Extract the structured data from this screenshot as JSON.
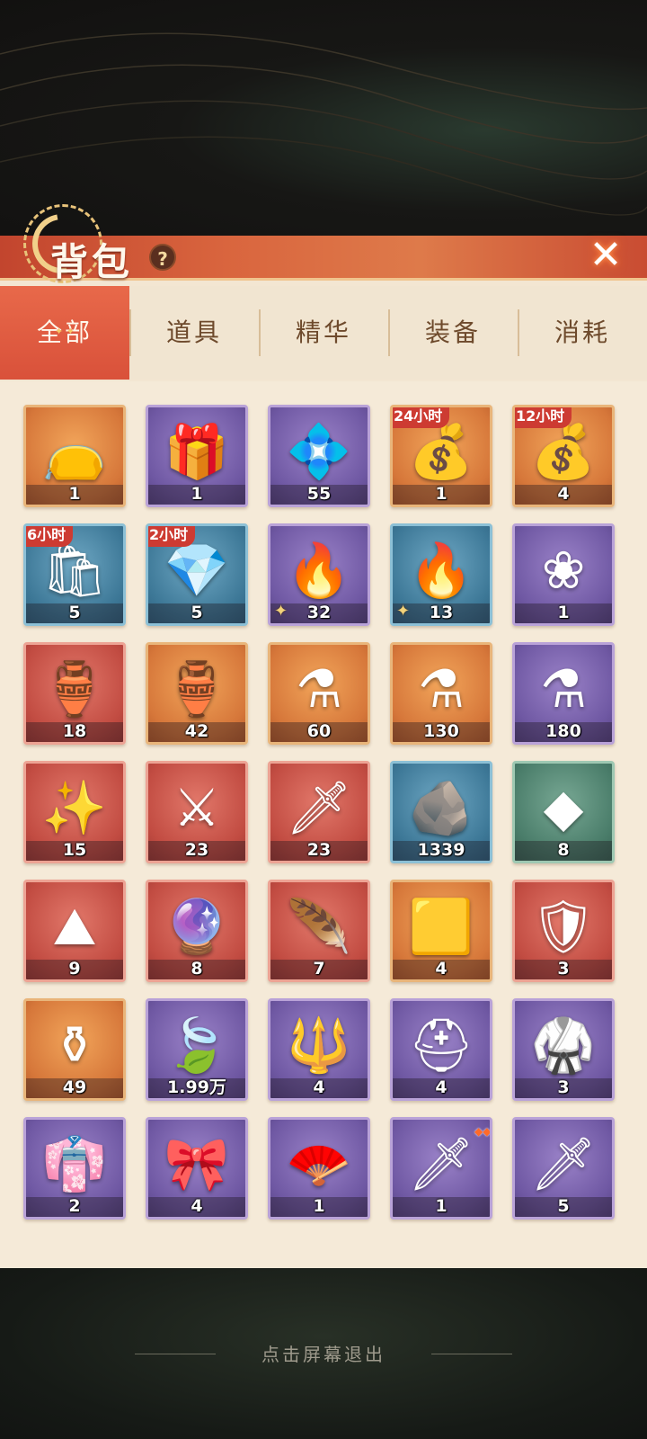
{
  "title": "背包",
  "help_icon": "?",
  "close_icon": "✕",
  "tabs": [
    {
      "label": "全部",
      "active": true
    },
    {
      "label": "道具",
      "active": false
    },
    {
      "label": "精华",
      "active": false
    },
    {
      "label": "装备",
      "active": false
    },
    {
      "label": "消耗",
      "active": false
    }
  ],
  "items": [
    {
      "count": "1",
      "color": "orange",
      "icon": "lucky-bag-icon",
      "glyph": "👝"
    },
    {
      "count": "1",
      "color": "purple",
      "icon": "gold-box-icon",
      "glyph": "🎁"
    },
    {
      "count": "55",
      "color": "purple",
      "icon": "glowing-chest-icon",
      "glyph": "💠"
    },
    {
      "count": "1",
      "color": "orange",
      "icon": "jade-treasure-chest-icon",
      "glyph": "💰",
      "timer": "24小时"
    },
    {
      "count": "4",
      "color": "orange",
      "icon": "jade-treasure-chest-icon",
      "glyph": "💰",
      "timer": "12小时"
    },
    {
      "count": "5",
      "color": "blue",
      "icon": "jade-sack-icon",
      "glyph": "🛍",
      "timer": "6小时"
    },
    {
      "count": "5",
      "color": "blue",
      "icon": "jade-tray-icon",
      "glyph": "💎",
      "timer": "2小时"
    },
    {
      "count": "32",
      "color": "purple",
      "icon": "purple-flame-soul-icon",
      "glyph": "🔥",
      "fragment": true
    },
    {
      "count": "13",
      "color": "blue",
      "icon": "blue-flame-soul-icon",
      "glyph": "🔥",
      "fragment": true
    },
    {
      "count": "1",
      "color": "purple",
      "icon": "blue-flower-icon",
      "glyph": "❀"
    },
    {
      "count": "18",
      "color": "red",
      "icon": "green-gourd-icon",
      "glyph": "🏺"
    },
    {
      "count": "42",
      "color": "orange",
      "icon": "purple-gourd-icon",
      "glyph": "🏺"
    },
    {
      "count": "60",
      "color": "orange",
      "icon": "red-potion-icon",
      "glyph": "⚗"
    },
    {
      "count": "130",
      "color": "orange",
      "icon": "green-potion-icon",
      "glyph": "⚗"
    },
    {
      "count": "180",
      "color": "purple",
      "icon": "pink-potion-icon",
      "glyph": "⚗"
    },
    {
      "count": "15",
      "color": "red",
      "icon": "golden-staff-icon",
      "glyph": "✨"
    },
    {
      "count": "23",
      "color": "red",
      "icon": "golden-spear-icon",
      "glyph": "⚔"
    },
    {
      "count": "23",
      "color": "red",
      "icon": "dark-dagger-icon",
      "glyph": "🗡"
    },
    {
      "count": "1339",
      "color": "blue",
      "icon": "ore-stone-icon",
      "glyph": "🪨"
    },
    {
      "count": "8",
      "color": "green",
      "icon": "dark-crystal-icon",
      "glyph": "◆"
    },
    {
      "count": "9",
      "color": "red",
      "icon": "crystal-dust-icon",
      "glyph": "⛰"
    },
    {
      "count": "8",
      "color": "red",
      "icon": "golden-pearl-icon",
      "glyph": "🔮"
    },
    {
      "count": "7",
      "color": "red",
      "icon": "phoenix-feather-icon",
      "glyph": "🪶"
    },
    {
      "count": "4",
      "color": "orange",
      "icon": "gold-crystal-icon",
      "glyph": "🟨"
    },
    {
      "count": "3",
      "color": "red",
      "icon": "sword-banner-icon",
      "glyph": "🛡"
    },
    {
      "count": "49",
      "color": "orange",
      "icon": "golden-vase-icon",
      "glyph": "⚱"
    },
    {
      "count": "1.99万",
      "color": "purple",
      "icon": "crystal-leaf-icon",
      "glyph": "🍃"
    },
    {
      "count": "4",
      "color": "purple",
      "icon": "golden-trident-icon",
      "glyph": "🔱"
    },
    {
      "count": "4",
      "color": "purple",
      "icon": "red-helmet-icon",
      "glyph": "⛑"
    },
    {
      "count": "3",
      "color": "purple",
      "icon": "gold-armor-icon",
      "glyph": "🥋"
    },
    {
      "count": "2",
      "color": "purple",
      "icon": "purple-robe-icon",
      "glyph": "👘"
    },
    {
      "count": "4",
      "color": "purple",
      "icon": "jade-belt-icon",
      "glyph": "🎀"
    },
    {
      "count": "1",
      "color": "purple",
      "icon": "feather-fan-icon",
      "glyph": "🪭"
    },
    {
      "count": "1",
      "color": "purple",
      "icon": "bronze-sword-icon",
      "glyph": "🗡",
      "stars": 3
    },
    {
      "count": "5",
      "color": "purple",
      "icon": "bronze-sword-icon",
      "glyph": "🗡"
    }
  ],
  "exit_hint": "点击屏幕退出"
}
